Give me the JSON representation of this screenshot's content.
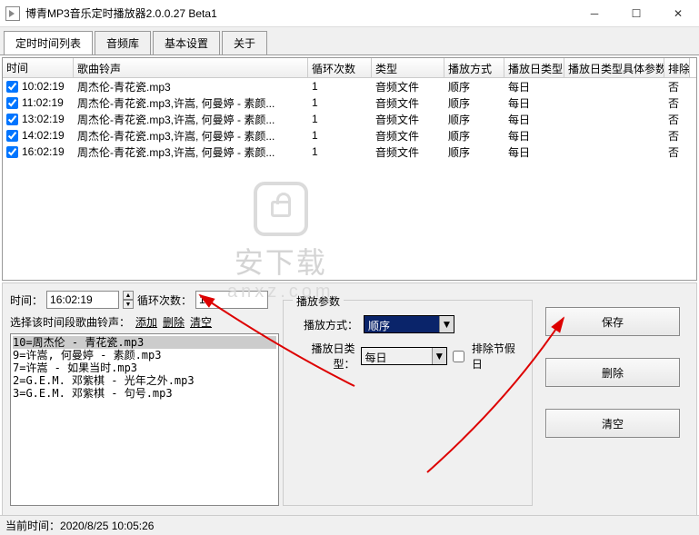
{
  "window": {
    "title": "博青MP3音乐定时播放器2.0.0.27 Beta1"
  },
  "tabs": [
    "定时时间列表",
    "音频库",
    "基本设置",
    "关于"
  ],
  "grid": {
    "headers": [
      "时间",
      "歌曲铃声",
      "循环次数",
      "类型",
      "播放方式",
      "播放日类型",
      "播放日类型具体参数",
      "排除"
    ],
    "rows": [
      {
        "checked": true,
        "time": "10:02:19",
        "song": "周杰伦-青花瓷.mp3",
        "loop": "1",
        "type": "音频文件",
        "mode": "顺序",
        "day": "每日",
        "param": "",
        "exc": "否"
      },
      {
        "checked": true,
        "time": "11:02:19",
        "song": "周杰伦-青花瓷.mp3,许嵩, 何曼婷 - 素颜...",
        "loop": "1",
        "type": "音频文件",
        "mode": "顺序",
        "day": "每日",
        "param": "",
        "exc": "否"
      },
      {
        "checked": true,
        "time": "13:02:19",
        "song": "周杰伦-青花瓷.mp3,许嵩, 何曼婷 - 素颜...",
        "loop": "1",
        "type": "音频文件",
        "mode": "顺序",
        "day": "每日",
        "param": "",
        "exc": "否"
      },
      {
        "checked": true,
        "time": "14:02:19",
        "song": "周杰伦-青花瓷.mp3,许嵩, 何曼婷 - 素颜...",
        "loop": "1",
        "type": "音频文件",
        "mode": "顺序",
        "day": "每日",
        "param": "",
        "exc": "否"
      },
      {
        "checked": true,
        "time": "16:02:19",
        "song": "周杰伦-青花瓷.mp3,许嵩, 何曼婷 - 素颜...",
        "loop": "1",
        "type": "音频文件",
        "mode": "顺序",
        "day": "每日",
        "param": "",
        "exc": "否"
      }
    ]
  },
  "form": {
    "time_label": "时间：",
    "time_value": "16:02:19",
    "loop_label": "循环次数：",
    "loop_value": "1",
    "select_label": "选择该时间段歌曲铃声：",
    "add": "添加",
    "del": "删除",
    "clear": "清空"
  },
  "songlist": [
    "10=周杰伦 - 青花瓷.mp3",
    "9=许嵩, 何曼婷 - 素颜.mp3",
    "7=许嵩 - 如果当时.mp3",
    "2=G.E.M. 邓紫棋 - 光年之外.mp3",
    "3=G.E.M. 邓紫棋 - 句号.mp3"
  ],
  "params": {
    "group_label": "播放参数",
    "mode_label": "播放方式：",
    "mode_value": "顺序",
    "day_label": "播放日类型：",
    "day_value": "每日",
    "exclude_label": "排除节假日"
  },
  "actions": {
    "save": "保存",
    "delete": "删除",
    "clear": "清空"
  },
  "status": {
    "label": "当前时间：",
    "value": "2020/8/25 10:05:26"
  },
  "watermark": {
    "name": "安下载",
    "sub": "anxz.com"
  }
}
